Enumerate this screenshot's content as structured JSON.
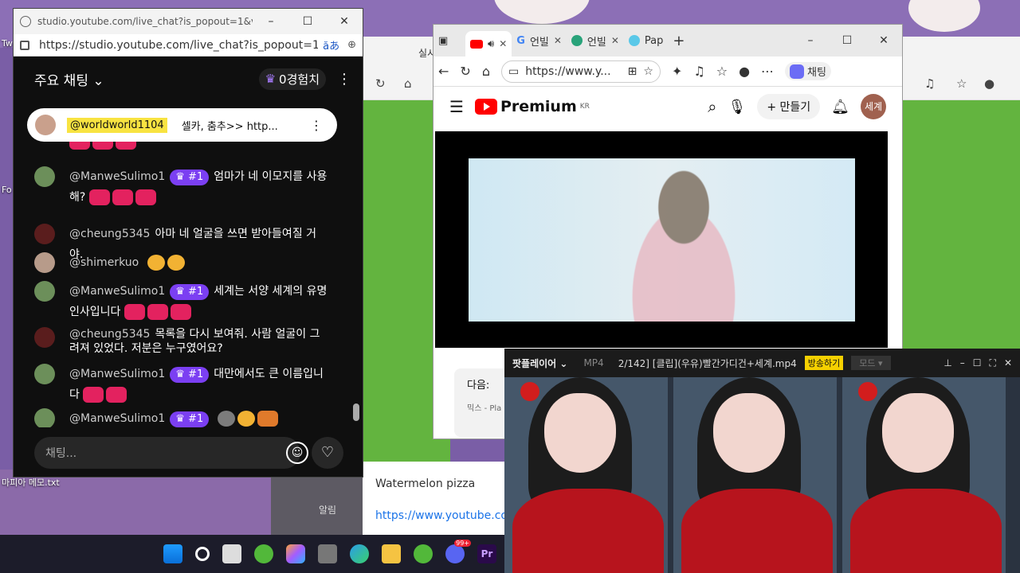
{
  "desktop": {
    "icon_label_1": "Tw",
    "icon_label_2": "Fo",
    "icon_file": "마피아 메모.txt"
  },
  "chat_popup": {
    "window_title": "studio.youtube.com/live_chat?is_popout=1&v=-w...",
    "url": "https://studio.youtube.com/live_chat?is_popout=1&...",
    "header_title": "주요 채팅",
    "xp_label": "0경험치",
    "pinned": {
      "user": "@worldworld1104",
      "text": "셀카, 춤추>> http..."
    },
    "messages": [
      {
        "user": "@ManweSulimo1",
        "badge": "#1",
        "text": "엄마가 네 이모지를 사용해?"
      },
      {
        "user": "@cheung5345",
        "text": "아마 네 얼굴을 쓰면 받아들여질 거야."
      },
      {
        "user": "@shimerkuo",
        "text": ""
      },
      {
        "user": "@ManweSulimo1",
        "badge": "#1",
        "text": "세계는 서양 세계의 유명 인사입니다"
      },
      {
        "user": "@cheung5345",
        "text": "목록을 다시 보여줘. 사람 얼굴이 그려져 있었다. 저분은 누구였어요?"
      },
      {
        "user": "@ManweSulimo1",
        "badge": "#1",
        "text": "대만에서도 큰 이름입니다"
      },
      {
        "user": "@ManweSulimo1",
        "badge": "#1",
        "text": ""
      }
    ],
    "input_placeholder": "채팅..."
  },
  "back_window": {
    "tab_title": "실시"
  },
  "browser": {
    "tabs": [
      {
        "label": ""
      },
      {
        "label": "언빌"
      },
      {
        "label": "언빌"
      },
      {
        "label": "Pap"
      }
    ],
    "url": "https://www.y...",
    "copilot_label": "채팅",
    "yt": {
      "brand": "Premium",
      "region": "KR",
      "create_label": "만들기",
      "avatar_label": "세계",
      "next_label": "다음:",
      "next_sub": "믹스 - Pla"
    }
  },
  "under": {
    "watermelon": "Watermelon pizza",
    "url": "https://www.youtube.co",
    "notif": "알림"
  },
  "media_player": {
    "name": "팟플레이어",
    "format": "MP4",
    "file": "2/142] [클립](우유)빨간가디건+세계.mp4",
    "broadcast": "방송하기",
    "mode": "모드"
  },
  "taskbar": {
    "discord_badge": "99+"
  }
}
